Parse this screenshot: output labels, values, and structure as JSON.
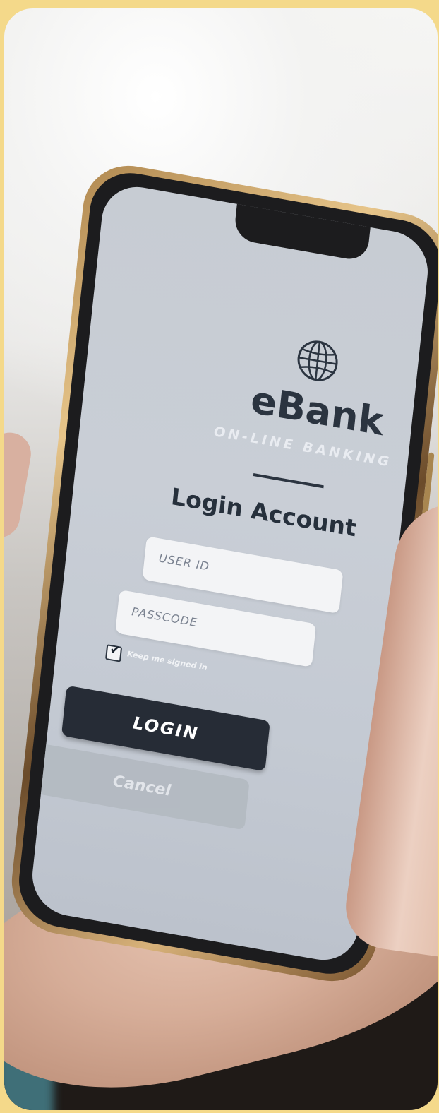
{
  "app": {
    "brand": "eBank",
    "tagline": "ON-LINE BANKING",
    "title": "Login Account"
  },
  "form": {
    "user_id_placeholder": "USER ID",
    "passcode_placeholder": "PASSCODE",
    "keep_signed_in_label": "Keep me signed in",
    "keep_signed_in_checked": true
  },
  "buttons": {
    "login_label": "LOGIN",
    "cancel_label": "Cancel"
  },
  "colors": {
    "screen_bg": "#c7ccd3",
    "brand_text": "#2b3440",
    "login_button": "#262c36",
    "cancel_button": "#b2b8c0",
    "phone_frame": "#c9a06a"
  },
  "icons": {
    "logo": "globe-icon",
    "checkbox": "check-icon"
  }
}
